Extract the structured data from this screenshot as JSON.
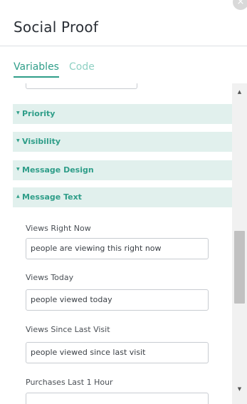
{
  "header": {
    "title": "Social Proof",
    "close_icon": "×"
  },
  "tabs": [
    {
      "label": "Variables",
      "active": true
    },
    {
      "label": "Code",
      "active": false
    }
  ],
  "sections": [
    {
      "label": "Priority",
      "arrow": "▼",
      "expanded": false
    },
    {
      "label": "Visibility",
      "arrow": "▼",
      "expanded": false
    },
    {
      "label": "Message Design",
      "arrow": "▼",
      "expanded": false
    },
    {
      "label": "Message Text",
      "arrow": "▲",
      "expanded": true
    }
  ],
  "fields": [
    {
      "label": "Views Right Now",
      "value": "people are viewing this right now"
    },
    {
      "label": "Views Today",
      "value": "people viewed today"
    },
    {
      "label": "Views Since Last Visit",
      "value": "people viewed since last visit"
    },
    {
      "label": "Purchases Last 1 Hour",
      "value": ""
    }
  ],
  "scrollbar": {
    "up_arrow": "▲",
    "down_arrow": "▼"
  },
  "colors": {
    "accent": "#2f9e89",
    "accent_light": "#8fd1c4",
    "section_bg": "#e1f0ed"
  }
}
